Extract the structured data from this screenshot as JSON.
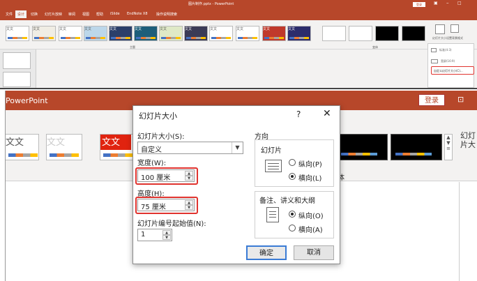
{
  "top": {
    "title": "图片制作.pptx - PowerPoint",
    "login": "登录",
    "tabs": [
      "文件",
      "设计",
      "切换",
      "幻灯片放映",
      "审阅",
      "视图",
      "帮助",
      "iSlide",
      "EndNote X8",
      "操作说明搜索"
    ],
    "active_tab_index": 1,
    "theme_thumb_text": "文文",
    "group_themes_label": "主题",
    "group_variants_label": "变体",
    "size_button_label": "幻灯片大小",
    "format_bg_label": "设置背景格式",
    "menu_items": [
      "标准(4:3)",
      "宽屏(16:9)",
      "自定义幻灯片大小(C)..."
    ]
  },
  "bottom": {
    "app_title": "PowerPoint",
    "login": "登录",
    "thumb_text": "文文",
    "side_label": "幻灯片大",
    "variants_group_label": "体",
    "accent_colors": [
      "#4472c4",
      "#ed7d31",
      "#a5a5a5",
      "#ffc000"
    ],
    "brand_color": "#b7472a"
  },
  "dialog": {
    "title": "幻灯片大小",
    "help": "?",
    "close": "✕",
    "size_label": "幻灯片大小(S):",
    "size_value": "自定义",
    "width_label": "宽度(W):",
    "width_value": "100 厘米",
    "height_label": "高度(H):",
    "height_value": "75 厘米",
    "number_label": "幻灯片编号起始值(N):",
    "number_value": "1",
    "orientation_label": "方向",
    "slides_label": "幻灯片",
    "portrait_label": "纵向(P)",
    "landscape_label": "横向(L)",
    "slides_selected": "landscape",
    "notes_label": "备注、讲义和大纲",
    "notes_portrait_label": "纵向(O)",
    "notes_landscape_label": "横向(A)",
    "notes_selected": "portrait",
    "ok_label": "确定",
    "cancel_label": "取消",
    "highlight_color": "#e0332e"
  }
}
